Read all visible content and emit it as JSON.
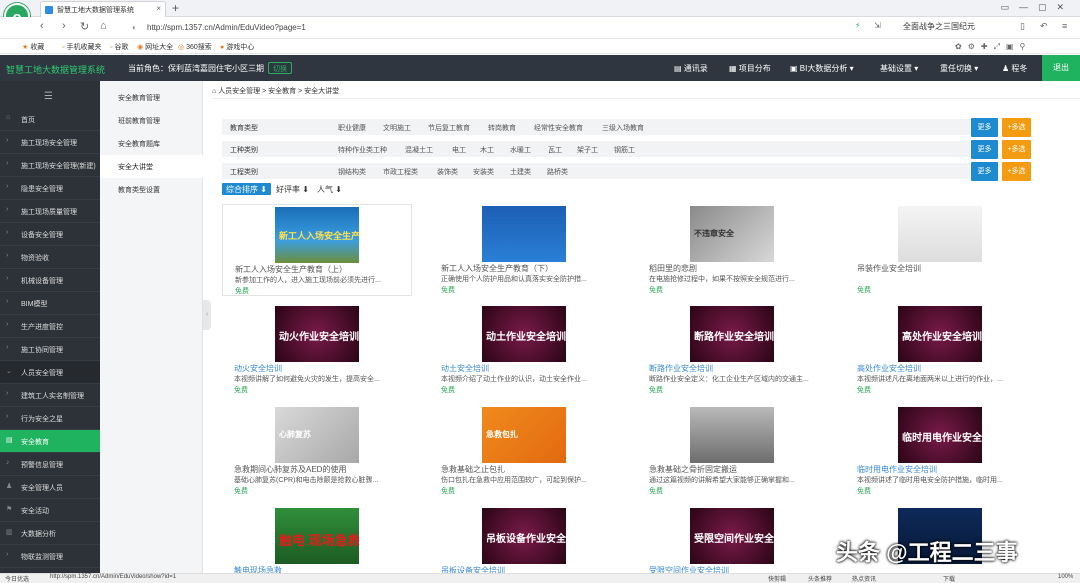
{
  "browser": {
    "tab_title": "智慧工地大数据管理系统",
    "new_tab": "+",
    "url": "http://spm.1357.cn/Admin/EduVideo?page=1",
    "search_text": "全面战争之三国纪元",
    "bookmarks": [
      "收藏",
      "手机收藏夹",
      "谷歌",
      "网址大全",
      "360搜索",
      "游戏中心"
    ]
  },
  "header": {
    "app_title": "智慧工地大数据管理系统",
    "role_label": "当前角色：保利蓝湾嘉园住宅小区三期",
    "role_button": "切换",
    "menu": [
      "通讯录",
      "项目分布",
      "BI大数据分析",
      "基础设置",
      "重任切换",
      "程冬"
    ],
    "logout": "退出"
  },
  "sidebar": {
    "items": [
      {
        "label": "首页",
        "icon": "home-icon",
        "state": ""
      },
      {
        "label": "施工现场安全管理",
        "icon": "chevron-right-icon",
        "state": ""
      },
      {
        "label": "施工现场安全管理(新建)",
        "icon": "chevron-right-icon",
        "state": ""
      },
      {
        "label": "隐患安全管理",
        "icon": "chevron-right-icon",
        "state": ""
      },
      {
        "label": "施工现场质量管理",
        "icon": "chevron-right-icon",
        "state": ""
      },
      {
        "label": "设备安全管理",
        "icon": "chevron-right-icon",
        "state": ""
      },
      {
        "label": "物资验收",
        "icon": "chevron-right-icon",
        "state": ""
      },
      {
        "label": "机械设备管理",
        "icon": "chevron-right-icon",
        "state": ""
      },
      {
        "label": "BIM模型",
        "icon": "chevron-right-icon",
        "state": ""
      },
      {
        "label": "生产进度管控",
        "icon": "chevron-right-icon",
        "state": ""
      },
      {
        "label": "施工协同管理",
        "icon": "chevron-right-icon",
        "state": ""
      },
      {
        "label": "人员安全管理",
        "icon": "chevron-down-icon",
        "state": "open"
      },
      {
        "label": "建筑工人实名制管理",
        "icon": "chevron-right-icon",
        "state": ""
      },
      {
        "label": "行为安全之星",
        "icon": "chevron-right-icon",
        "state": ""
      },
      {
        "label": "安全教育",
        "icon": "book-icon",
        "state": "active"
      },
      {
        "label": "预警信息管理",
        "icon": "bell-icon",
        "state": ""
      },
      {
        "label": "安全管理人员",
        "icon": "user-icon",
        "state": ""
      },
      {
        "label": "安全活动",
        "icon": "flag-icon",
        "state": ""
      },
      {
        "label": "大数据分析",
        "icon": "chart-icon",
        "state": ""
      },
      {
        "label": "物联监测管理",
        "icon": "chevron-right-icon",
        "state": ""
      }
    ]
  },
  "submenu": {
    "items": [
      "安全教育管理",
      "班前教育管理",
      "安全教育题库",
      "安全大讲堂",
      "教育类型设置"
    ],
    "active_index": 3
  },
  "breadcrumb": {
    "text": "人员安全管理 > 安全教育 > 安全大讲堂"
  },
  "filters": [
    {
      "label": "教育类型",
      "values": [
        "职业健康",
        "文明施工",
        "节后复工教育",
        "转岗教育",
        "经常性安全教育",
        "三级入场教育"
      ]
    },
    {
      "label": "工种类别",
      "values": [
        "特种作业类工种",
        "混凝土工",
        "电工",
        "木工",
        "水暖工",
        "瓦工",
        "架子工",
        "钢筋工"
      ]
    },
    {
      "label": "工程类别",
      "values": [
        "钢结构类",
        "市政工程类",
        "装饰类",
        "安装类",
        "土建类",
        "路桥类"
      ]
    }
  ],
  "filter_buttons": {
    "more": "更多",
    "multi": "+多选"
  },
  "sort": [
    "综合排序 ⬇",
    "好评率 ⬇",
    "人气 ⬇"
  ],
  "videos": [
    {
      "title": "新工人入场安全生产教育（上）",
      "desc": "新参加工作的人，进入施工现场前必须先进行...",
      "price": "免费",
      "caption": "新工人入场安全生产教育"
    },
    {
      "title": "新工人入场安全生产教育（下）",
      "desc": "正确使用个人防护用品和认真落实安全防护措...",
      "price": "免费",
      "caption": ""
    },
    {
      "title": "稻田里的悲剧",
      "desc": "在电施抢修过程中，如果不按照安全规范进行...",
      "price": "免费",
      "caption": "不违章安全"
    },
    {
      "title": "吊装作业安全培训",
      "desc": "",
      "price": "免费",
      "caption": ""
    },
    {
      "title": "动火安全培训",
      "desc": "本视频讲解了如何避免火灾的发生，提高安全...",
      "price": "免费",
      "caption": "动火作业安全培训"
    },
    {
      "title": "动土安全培训",
      "desc": "本视频介绍了动土作业的认识，动土安全作业...",
      "price": "免费",
      "caption": "动土作业安全培训"
    },
    {
      "title": "断路作业安全培训",
      "desc": "断路作业安全定义：化工企业生产区域内的交通主...",
      "price": "免费",
      "caption": "断路作业安全培训"
    },
    {
      "title": "高处作业安全培训",
      "desc": "本视频讲述凡在离地面两米以上进行的作业，...",
      "price": "免费",
      "caption": "高处作业安全培训"
    },
    {
      "title": "急救期间心肺复苏及AED的使用",
      "desc": "基础心肺复苏(CPR)和电击除颤是抢救心脏骤...",
      "price": "免费",
      "caption": "心肺复苏"
    },
    {
      "title": "急救基础之止包扎",
      "desc": "伤口包扎在急救中应用范围较广，可起到保护...",
      "price": "免费",
      "caption": "急救包扎"
    },
    {
      "title": "急救基础之骨折固定搬运",
      "desc": "通过这篇视频的讲解希望大家能够正确掌握和...",
      "price": "免费",
      "caption": ""
    },
    {
      "title": "临时用电作业安全培训",
      "desc": "本视频讲述了临时用电安全防护措施，临时用...",
      "price": "免费",
      "caption": "临时用电作业安全培训"
    },
    {
      "title": "触电现场急救",
      "desc": "",
      "price": "",
      "caption": "触电 现场急救"
    },
    {
      "title": "吊板设备安全培训",
      "desc": "",
      "price": "",
      "caption": "吊板设备作业安全培训"
    },
    {
      "title": "受限空间作业安全培训",
      "desc": "",
      "price": "",
      "caption": "受限空间作业安全培训"
    },
    {
      "title": "",
      "desc": "",
      "price": "",
      "caption": ""
    }
  ],
  "statusbar": {
    "left": "今日优选",
    "url": "http://spm.1357.cn/Admin/EduVideo/show?id=1",
    "items": [
      "快剪辑",
      "头条推荐",
      "热点资讯",
      "下载",
      "100%"
    ]
  },
  "watermark": "头条 @工程二三事"
}
